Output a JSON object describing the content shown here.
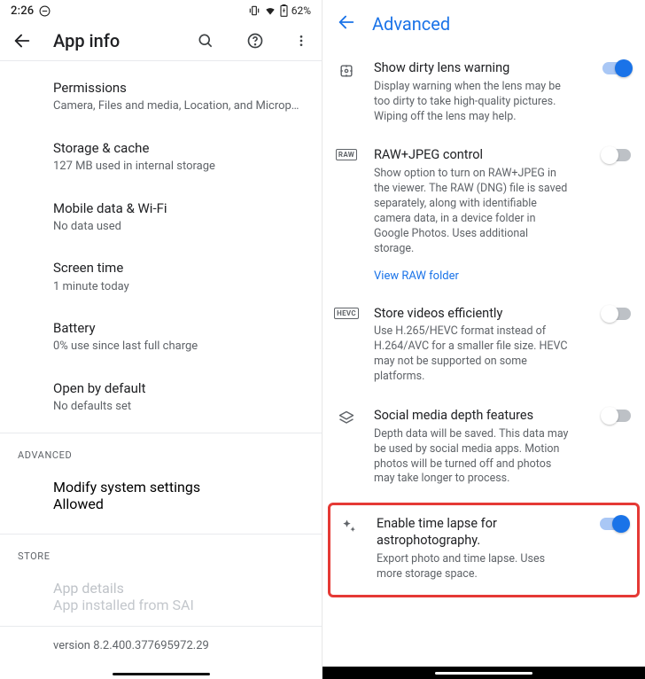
{
  "statusbar": {
    "time": "2:26",
    "battery": "62%"
  },
  "left": {
    "header": {
      "title": "App info"
    },
    "rows": {
      "permissions": {
        "title": "Permissions",
        "sub": "Camera, Files and media, Location, and Microp…"
      },
      "storage": {
        "title": "Storage & cache",
        "sub": "127 MB used in internal storage"
      },
      "data": {
        "title": "Mobile data & Wi-Fi",
        "sub": "No data used"
      },
      "screentime": {
        "title": "Screen time",
        "sub": "1 minute today"
      },
      "battery": {
        "title": "Battery",
        "sub": "0% use since last full charge"
      },
      "openby": {
        "title": "Open by default",
        "sub": "No defaults set"
      }
    },
    "sections": {
      "advanced": "ADVANCED",
      "store": "STORE"
    },
    "advanced": {
      "modify": {
        "title": "Modify system settings",
        "sub": "Allowed"
      }
    },
    "store": {
      "details": {
        "title": "App details",
        "sub": "App installed from SAI"
      }
    },
    "version": "version 8.2.400.377695972.29"
  },
  "right": {
    "header": {
      "title": "Advanced"
    },
    "items": {
      "dirty": {
        "title": "Show dirty lens warning",
        "sub": "Display warning when the lens may be too dirty to take high-quality pictures. Wiping off the lens may help.",
        "on": true,
        "icon": "burst"
      },
      "raw": {
        "title": "RAW+JPEG control",
        "sub": "Show option to turn on RAW+JPEG in the viewer. The RAW (DNG) file is saved separately, along with identifiable camera data, in a device folder in Google Photos. Uses additional storage.",
        "link": "View RAW folder",
        "on": false,
        "icon_text": "RAW"
      },
      "hevc": {
        "title": "Store videos efficiently",
        "sub": "Use H.265/HEVC format instead of H.264/AVC for a smaller file size. HEVC may not be supported on some platforms.",
        "on": false,
        "icon_text": "HEVC"
      },
      "depth": {
        "title": "Social media depth features",
        "sub": "Depth data will be saved. This data may be used by social media apps. Motion photos will be turned off and photos may take longer to process.",
        "on": false,
        "icon": "layers"
      },
      "astro": {
        "title": "Enable time lapse for astrophotography.",
        "sub": "Export photo and time lapse. Uses more storage space.",
        "on": true,
        "icon": "sparkle"
      }
    }
  }
}
